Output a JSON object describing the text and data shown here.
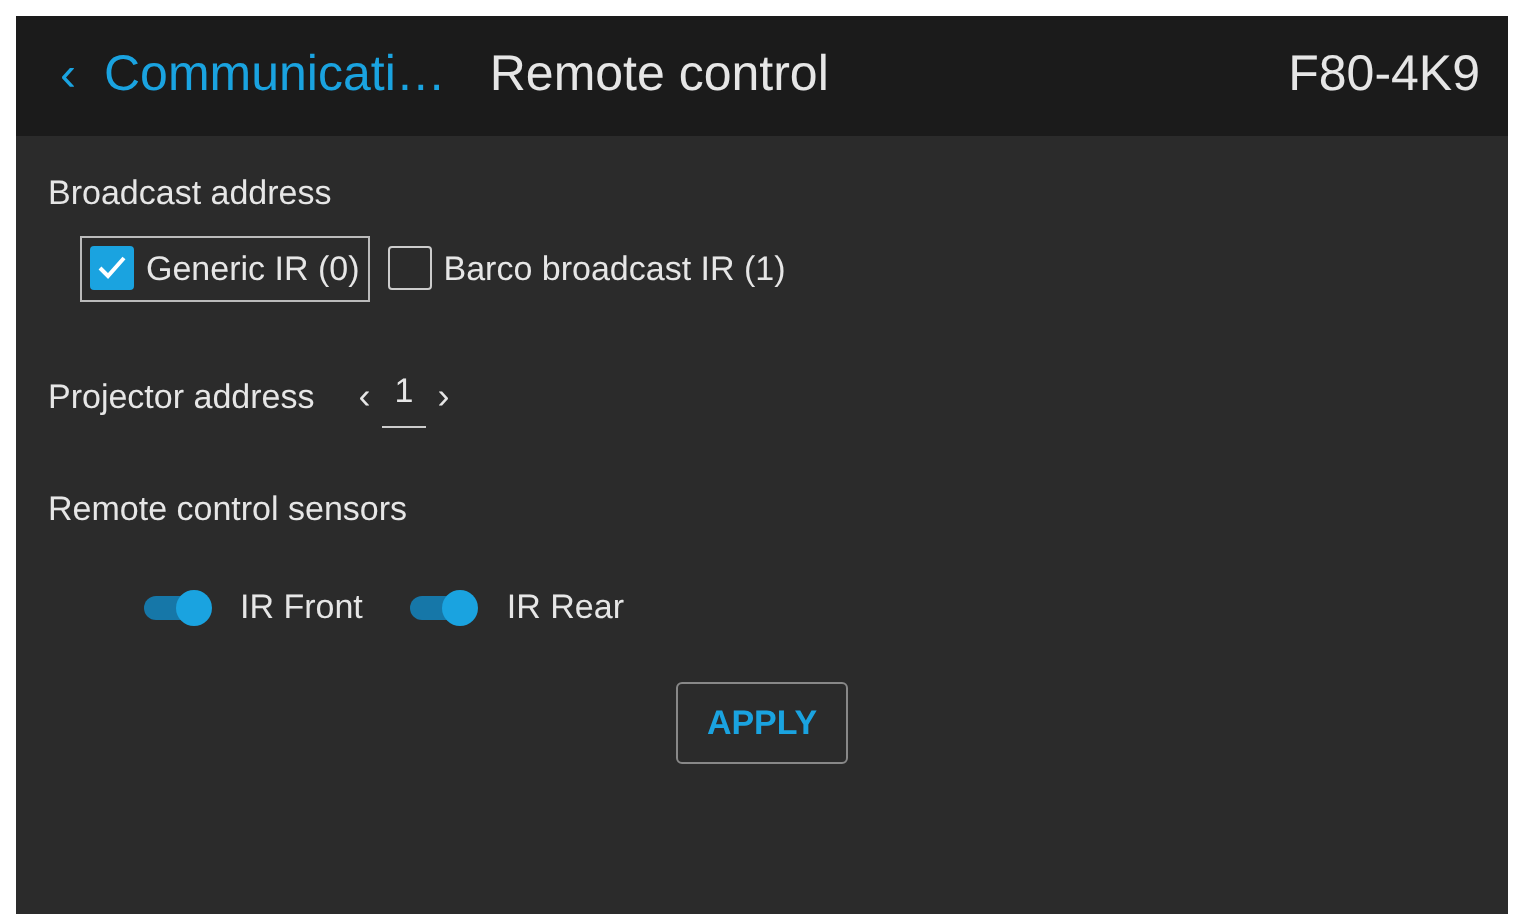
{
  "header": {
    "back_icon": "‹",
    "breadcrumb": "Communicati…",
    "title": "Remote control",
    "device": "F80-4K9"
  },
  "broadcast_address": {
    "label": "Broadcast address",
    "options": [
      {
        "label": "Generic IR (0)",
        "checked": true,
        "focused": true
      },
      {
        "label": "Barco broadcast IR (1)",
        "checked": false,
        "focused": false
      }
    ]
  },
  "projector_address": {
    "label": "Projector address",
    "prev": "‹",
    "value": "1",
    "next": "›"
  },
  "sensors": {
    "label": "Remote control sensors",
    "toggles": [
      {
        "label": "IR Front",
        "on": true
      },
      {
        "label": "IR Rear",
        "on": true
      }
    ]
  },
  "apply_button": "APPLY"
}
